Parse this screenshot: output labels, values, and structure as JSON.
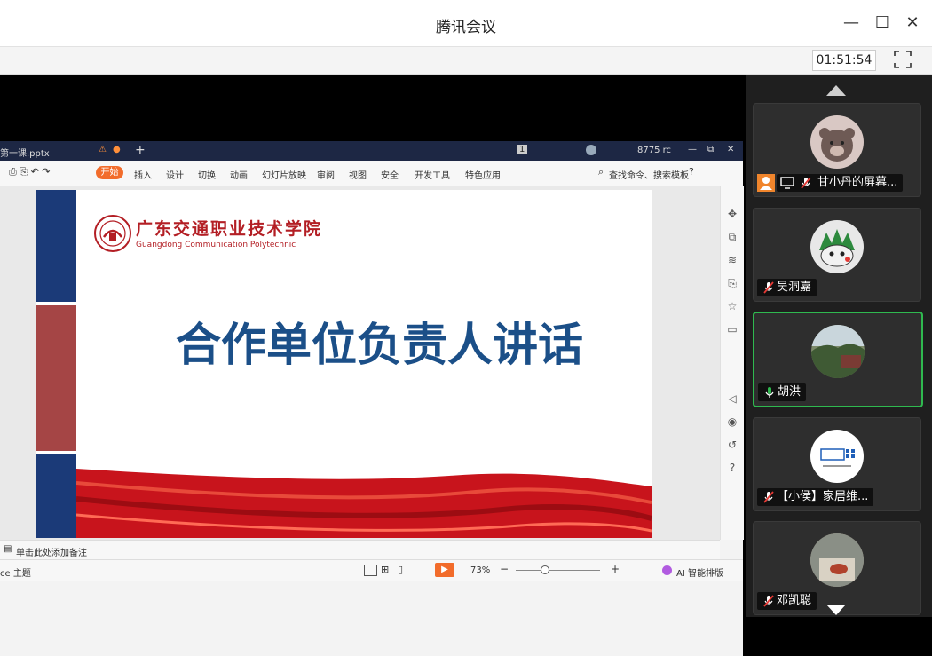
{
  "window": {
    "title": "腾讯会议",
    "minimize": "—",
    "maximize": "☐",
    "close": "✕"
  },
  "toolbar": {
    "timer": "01:51:54"
  },
  "ppt": {
    "file_tab": "第一课.pptx",
    "tab_badge": "1",
    "top_text": "8775 rc",
    "start_label": "开始",
    "menu": [
      "插入",
      "设计",
      "切换",
      "动画",
      "幻灯片放映",
      "审阅",
      "视图",
      "安全",
      "开发工具",
      "特色应用"
    ],
    "search": "查找命令、搜索模板",
    "slide": {
      "title": "合作单位负责人讲话",
      "logo_cn": "广东交通职业技术学院",
      "logo_en": "Guangdong Communication Polytechnic"
    },
    "notes_placeholder": "单击此处添加备注",
    "status_left": "ce 主题",
    "zoom": "73%",
    "ai_label": "AI 智能排版"
  },
  "participants": [
    {
      "name": "甘小丹的屏幕...",
      "muted": true,
      "sharing": true
    },
    {
      "name": "吴洞嘉",
      "muted": true
    },
    {
      "name": "胡洪",
      "muted": false,
      "active": true
    },
    {
      "name": "【小侯】家居维...",
      "muted": true
    },
    {
      "name": "邓凯聪",
      "muted": true
    }
  ],
  "colors": {
    "accent_green": "#2fb94f",
    "ppt_orange": "#f26c2b",
    "slide_blue": "#1b4f88",
    "slide_red": "#b31e24"
  }
}
